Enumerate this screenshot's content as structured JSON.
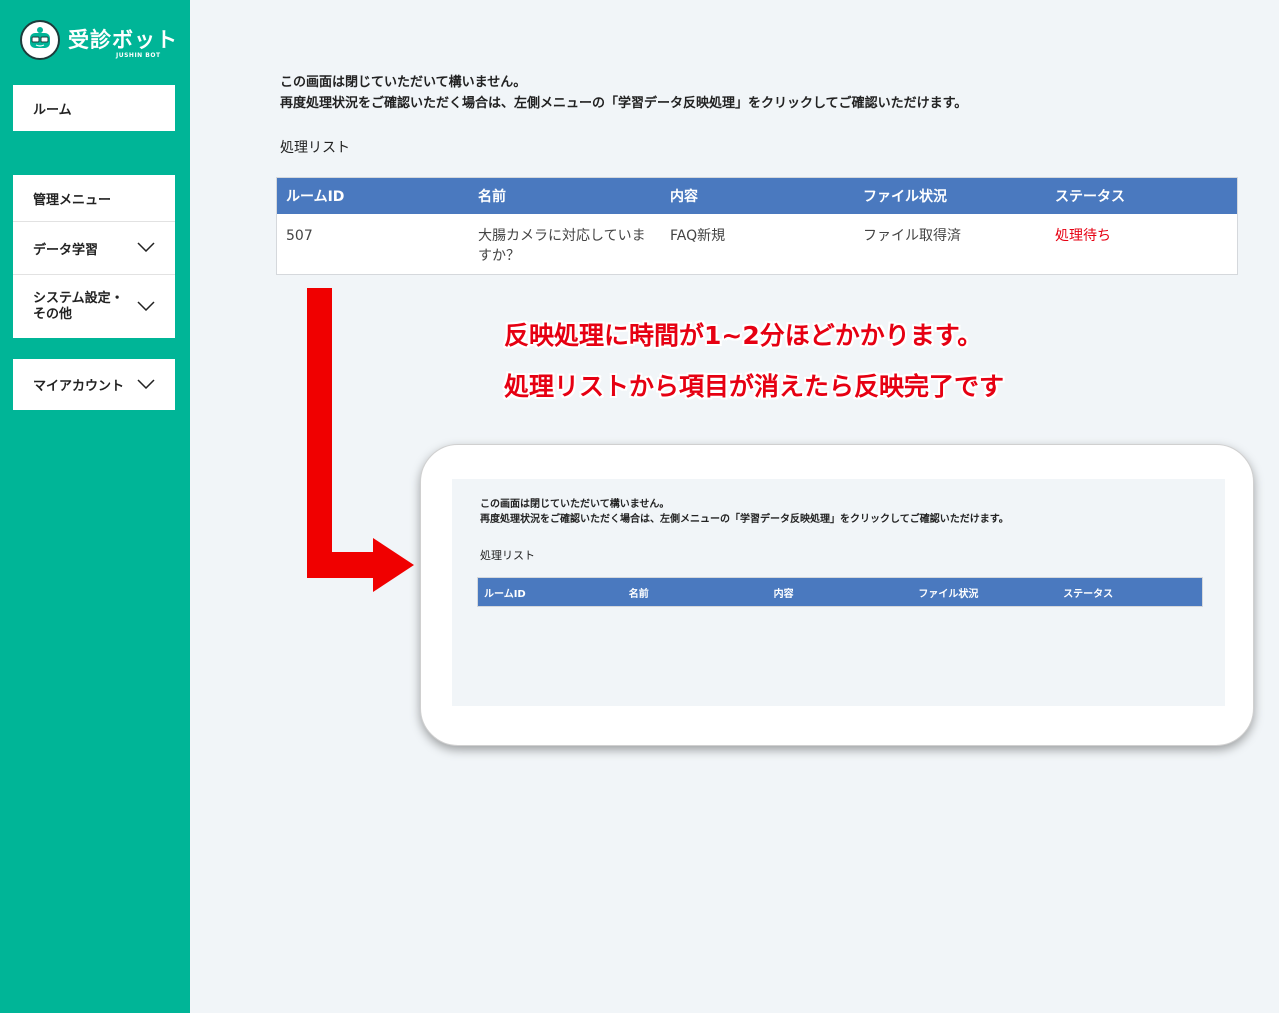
{
  "brand": {
    "title": "受診ボット",
    "subtitle": "JUSHIN BOT",
    "badge_text": "JUSHIN"
  },
  "sidebar": {
    "room": "ルーム",
    "admin_menu": "管理メニュー",
    "data_learning": "データ学習",
    "system_settings": "システム設定・その他",
    "my_account": "マイアカウント"
  },
  "main": {
    "notice_line1": "この画面は閉じていただいて構いません。",
    "notice_line2": "再度処理状況をご確認いただく場合は、左側メニューの「学習データ反映処理」をクリックしてご確認いただけます。",
    "list_title": "処理リスト",
    "columns": [
      "ルームID",
      "名前",
      "内容",
      "ファイル状況",
      "ステータス"
    ],
    "rows": [
      {
        "room_id": "507",
        "name": "大腸カメラに対応していますか？",
        "content": "FAQ新規",
        "file_status": "ファイル取得済",
        "status": "処理待ち"
      }
    ]
  },
  "annotation": {
    "line1": "反映処理に時間が1~2分ほどかかります。",
    "line2": "処理リストから項目が消えたら反映完了です"
  },
  "preview": {
    "notice_line1": "この画面は閉じていただいて構いません。",
    "notice_line2": "再度処理状況をご確認いただく場合は、左側メニューの「学習データ反映処理」をクリックしてご確認いただけます。",
    "list_title": "処理リスト",
    "columns": [
      "ルームID",
      "名前",
      "内容",
      "ファイル状況",
      "ステータス"
    ]
  },
  "colors": {
    "sidebar": "#00b597",
    "table_header": "#4a79bf",
    "annotation": "#e60012",
    "background": "#f1f5f8"
  },
  "icons": [
    "chevron-down-icon",
    "jushin-bot-logo"
  ]
}
